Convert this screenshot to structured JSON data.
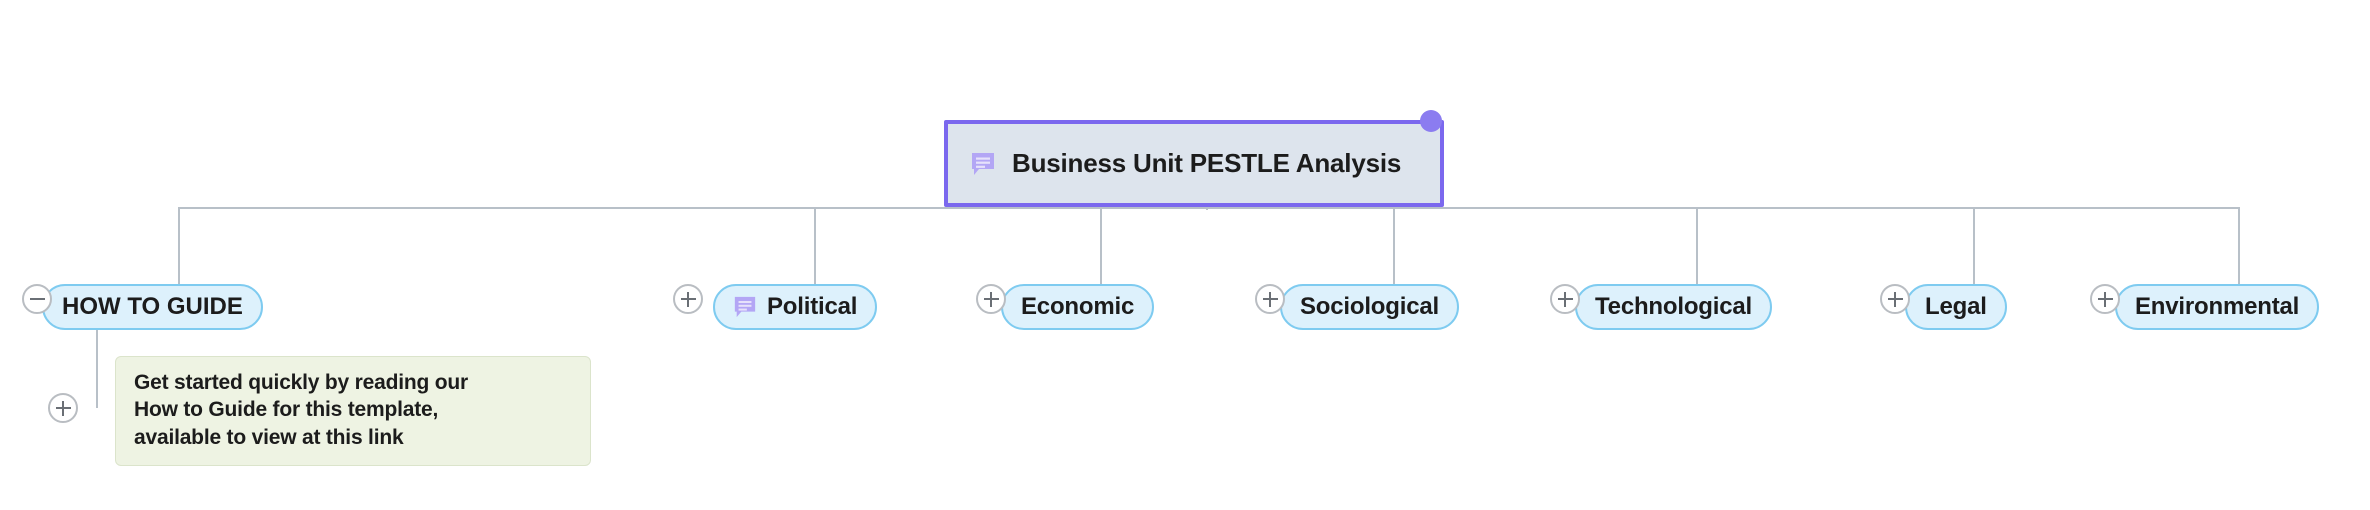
{
  "diagram": {
    "type": "mind-map",
    "root": {
      "label": "Business Unit PESTLE Analysis",
      "icon": "comment-bubble-icon",
      "selected": true,
      "fill_color": "#dde4ed",
      "border_color": "#7b68ee",
      "handle_color": "#8b7cf0"
    },
    "branch_style": {
      "fill_color": "#ddf1fc",
      "border_color": "#7ecbf0",
      "connector_color": "#b8c0c8"
    },
    "branches": [
      {
        "label": "HOW TO GUIDE",
        "toggle": "minus",
        "toggle_state": "expanded",
        "icon": null
      },
      {
        "label": "Political",
        "toggle": "plus",
        "toggle_state": "collapsed",
        "icon": "comment-bubble-icon"
      },
      {
        "label": "Economic",
        "toggle": "plus",
        "toggle_state": "collapsed",
        "icon": null
      },
      {
        "label": "Sociological",
        "toggle": "plus",
        "toggle_state": "collapsed",
        "icon": null
      },
      {
        "label": "Technological",
        "toggle": "plus",
        "toggle_state": "collapsed",
        "icon": null
      },
      {
        "label": "Legal",
        "toggle": "plus",
        "toggle_state": "collapsed",
        "icon": null
      },
      {
        "label": "Environmental",
        "toggle": "plus",
        "toggle_state": "collapsed",
        "icon": null
      }
    ],
    "note": {
      "parent": "HOW TO GUIDE",
      "toggle": "plus",
      "toggle_state": "collapsed",
      "fill_color": "#eef3e3",
      "border_color": "#dbe4cb",
      "lines": [
        "Get started quickly by reading our",
        "How to Guide for this template,",
        "available to view at this link"
      ]
    }
  }
}
